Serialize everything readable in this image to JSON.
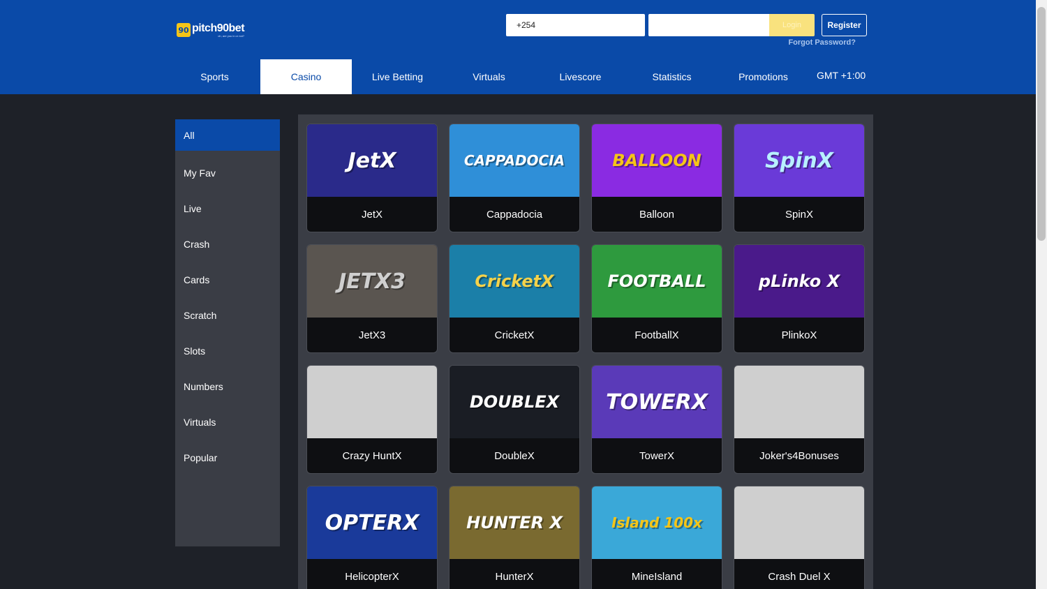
{
  "header": {
    "logo_text": "pitch90bet",
    "logo_badge": "90",
    "logo_tagline": "oh, are you in or not?",
    "phone_value": "+254",
    "password_placeholder": "",
    "login_label": "Login",
    "register_label": "Register",
    "forgot_label": "Forgot Password?"
  },
  "nav": {
    "items": [
      {
        "label": "Sports"
      },
      {
        "label": "Casino"
      },
      {
        "label": "Live Betting"
      },
      {
        "label": "Virtuals"
      },
      {
        "label": "Livescore"
      },
      {
        "label": "Statistics"
      },
      {
        "label": "Promotions"
      }
    ],
    "active": "Casino",
    "gmt_label": "GMT +1:00"
  },
  "sidebar": {
    "categories": [
      "All",
      "My Fav",
      "Live",
      "Crash",
      "Cards",
      "Scratch",
      "Slots",
      "Numbers",
      "Virtuals",
      "Popular"
    ],
    "active": "All"
  },
  "games": [
    {
      "name": "JetX",
      "thumb_text": "JetX",
      "bg": "#2a2a8a",
      "fg": "#ffffff"
    },
    {
      "name": "Cappadocia",
      "thumb_text": "CAPPADOCIA",
      "bg": "#2f8fd8",
      "fg": "#ffffff"
    },
    {
      "name": "Balloon",
      "thumb_text": "BALLOON",
      "bg": "#8a2be2",
      "fg": "#f5c518"
    },
    {
      "name": "SpinX",
      "thumb_text": "SpinX",
      "bg": "#6a3ad8",
      "fg": "#b8f0ff"
    },
    {
      "name": "JetX3",
      "thumb_text": "JETX3",
      "bg": "#5a5550",
      "fg": "#cfcfcf"
    },
    {
      "name": "CricketX",
      "thumb_text": "CricketX",
      "bg": "#1b7fa8",
      "fg": "#f5d24a"
    },
    {
      "name": "FootballX",
      "thumb_text": "FOOTBALL",
      "bg": "#2e9a3e",
      "fg": "#ffffff"
    },
    {
      "name": "PlinkoX",
      "thumb_text": "pLinko X",
      "bg": "#4a1a8a",
      "fg": "#ffffff"
    },
    {
      "name": "Crazy HuntX",
      "thumb_text": "",
      "bg": "#cfcfcf",
      "fg": "#cfcfcf"
    },
    {
      "name": "DoubleX",
      "thumb_text": "DOUBLEX",
      "bg": "#1a1d24",
      "fg": "#ffffff"
    },
    {
      "name": "TowerX",
      "thumb_text": "TOWERX",
      "bg": "#5a3ab8",
      "fg": "#ffffff"
    },
    {
      "name": "Joker's4Bonuses",
      "thumb_text": "",
      "bg": "#cfcfcf",
      "fg": "#cfcfcf"
    },
    {
      "name": "HelicopterX",
      "thumb_text": "OPTERX",
      "bg": "#1a3a9a",
      "fg": "#ffffff"
    },
    {
      "name": "HunterX",
      "thumb_text": "HUNTER X",
      "bg": "#7a6a30",
      "fg": "#ffffff"
    },
    {
      "name": "MineIsland",
      "thumb_text": "Island 100x",
      "bg": "#3aa8d8",
      "fg": "#f5c518"
    },
    {
      "name": "Crash Duel X",
      "thumb_text": "",
      "bg": "#cfcfcf",
      "fg": "#cfcfcf"
    }
  ],
  "colors": {
    "header_bg": "#0a4aa8",
    "page_bg": "#1e2128",
    "panel_bg": "#3a3d45",
    "accent_yellow": "#f5c518"
  }
}
